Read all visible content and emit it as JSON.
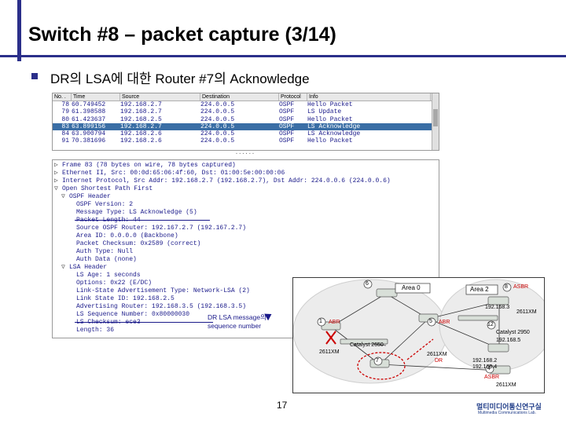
{
  "slide": {
    "title": "Switch #8 – packet capture (3/14)",
    "bullet": "DR의 LSA에 대한 Router #7의 Acknowledge",
    "page_number": "17",
    "logo_korean": "멀티미디어통신연구실",
    "logo_english": "Multimedia Communications Lab."
  },
  "packet_list": {
    "columns": [
      "No. .",
      "Time",
      "Source",
      "Destination",
      "Protocol",
      "Info"
    ],
    "rows": [
      {
        "no": "78",
        "time": "60.749452",
        "src": "192.168.2.7",
        "dst": "224.0.0.5",
        "proto": "OSPF",
        "info": "Hello Packet",
        "selected": false
      },
      {
        "no": "79",
        "time": "61.398588",
        "src": "192.168.2.7",
        "dst": "224.0.0.5",
        "proto": "OSPF",
        "info": "LS Update",
        "selected": false
      },
      {
        "no": "80",
        "time": "61.423637",
        "src": "192.168.2.5",
        "dst": "224.0.0.5",
        "proto": "OSPF",
        "info": "Hello Packet",
        "selected": false
      },
      {
        "no": "83",
        "time": "63.899156",
        "src": "192.168.2.7",
        "dst": "224.0.0.5",
        "proto": "OSPF",
        "info": "LS Acknowledge",
        "selected": true
      },
      {
        "no": "84",
        "time": "63.900794",
        "src": "192.168.2.6",
        "dst": "224.0.0.5",
        "proto": "OSPF",
        "info": "LS Acknowledge",
        "selected": false
      },
      {
        "no": "91",
        "time": "70.381696",
        "src": "192.168.2.6",
        "dst": "224.0.0.5",
        "proto": "OSPF",
        "info": "Hello Packet",
        "selected": false
      }
    ]
  },
  "splitter": "......",
  "detail_lines": [
    {
      "indent": 0,
      "twisty": "right",
      "text": "Frame 83 (78 bytes on wire, 78 bytes captured)"
    },
    {
      "indent": 0,
      "twisty": "right",
      "text": "Ethernet II, Src: 00:0d:65:06:4f:60, Dst: 01:00:5e:00:00:06"
    },
    {
      "indent": 0,
      "twisty": "right",
      "text": "Internet Protocol, Src Addr: 192.168.2.7 (192.168.2.7), Dst Addr: 224.0.0.6 (224.0.0.6)"
    },
    {
      "indent": 0,
      "twisty": "down",
      "text": "Open Shortest Path First"
    },
    {
      "indent": 1,
      "twisty": "down",
      "text": "OSPF Header"
    },
    {
      "indent": 2,
      "twisty": "",
      "text": "OSPF Version: 2"
    },
    {
      "indent": 2,
      "twisty": "",
      "text": "Message Type: LS Acknowledge (5)"
    },
    {
      "indent": 2,
      "twisty": "",
      "text": "Packet Length: 44"
    },
    {
      "indent": 2,
      "twisty": "",
      "text": "Source OSPF Router: 192.167.2.7 (192.167.2.7)"
    },
    {
      "indent": 2,
      "twisty": "",
      "text": "Area ID: 0.0.0.0 (Backbone)"
    },
    {
      "indent": 2,
      "twisty": "",
      "text": "Packet Checksum: 0x2589 (correct)"
    },
    {
      "indent": 2,
      "twisty": "",
      "text": "Auth Type: Null"
    },
    {
      "indent": 2,
      "twisty": "",
      "text": "Auth Data (none)"
    },
    {
      "indent": 1,
      "twisty": "down",
      "text": "LSA Header"
    },
    {
      "indent": 2,
      "twisty": "",
      "text": "LS Age: 1 seconds"
    },
    {
      "indent": 2,
      "twisty": "",
      "text": "Options: 0x22 (E/DC)"
    },
    {
      "indent": 2,
      "twisty": "",
      "text": "Link-State Advertisement Type: Network-LSA (2)"
    },
    {
      "indent": 2,
      "twisty": "",
      "text": "Link State ID: 192.168.2.5"
    },
    {
      "indent": 2,
      "twisty": "",
      "text": "Advertising Router: 192.168.3.5 (192.168.3.5)"
    },
    {
      "indent": 2,
      "twisty": "",
      "text": "LS Sequence Number: 0x80000030"
    },
    {
      "indent": 2,
      "twisty": "",
      "text": "LS Checksum: ece3"
    },
    {
      "indent": 2,
      "twisty": "",
      "text": "Length: 36"
    }
  ],
  "annotation": {
    "line1": "DR LSA message의",
    "line2": "sequence number"
  },
  "topology": {
    "area0": "Area 0",
    "area2": "Area 2",
    "asbr_top": "ASBR",
    "asbr_bottom": "ASBR",
    "abr_left": "ABR",
    "abr_right": "ABR",
    "dr": "DR",
    "catalyst_2650": "Catalyst 2650",
    "catalyst_2950": "Catalyst 2950",
    "model_2611xm_left": "2611XM",
    "model_2611xm_mid": "2611XM",
    "model_2611xm_right": "2611XM",
    "model_2611xm_bottom": "2611XM",
    "ip_192_168_3": "192.168.3",
    "ip_192_168_5": "192.168.5",
    "ip_192_168_2": "192.168.2",
    "ip_192_168_4": "192.168.4",
    "node_labels": [
      "6",
      "8",
      "1",
      "5",
      "12",
      "7",
      "4"
    ]
  }
}
